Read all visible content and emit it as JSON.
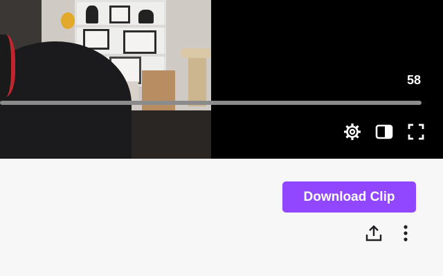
{
  "player": {
    "time_display": "58",
    "controls": [
      {
        "icon": "gear-icon",
        "purpose": "settings"
      },
      {
        "icon": "sidebar-toggle-icon",
        "purpose": "theatre-mode"
      },
      {
        "icon": "fullscreen-icon",
        "purpose": "fullscreen"
      }
    ]
  },
  "actions": {
    "download_label": "Download Clip",
    "share_icon": "share-icon",
    "more_icon": "more-vertical-icon"
  },
  "colors": {
    "accent": "#9147ff",
    "player_bg": "#000000",
    "page_bg": "#f7f7f8"
  }
}
